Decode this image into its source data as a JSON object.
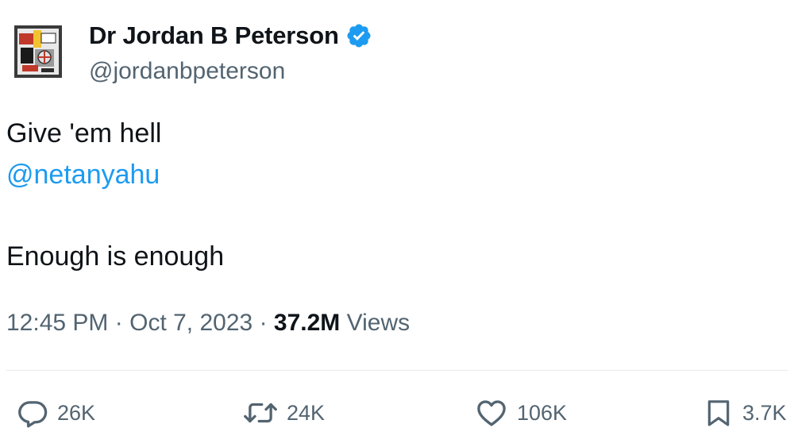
{
  "author": {
    "display_name": "Dr Jordan B Peterson",
    "handle": "@jordanbpeterson",
    "verified": true,
    "verified_badge_color": "#1d9bf0",
    "avatar_icon": "avatar-image"
  },
  "tweet": {
    "line1": "Give 'em hell",
    "mention": "@netanyahu",
    "line3": "Enough is enough",
    "mention_color": "#1d9bf0"
  },
  "meta": {
    "time": "12:45 PM",
    "separator": "·",
    "date": "Oct 7, 2023",
    "views_count": "37.2M",
    "views_label": "Views"
  },
  "actions": {
    "reply": {
      "icon": "reply-icon",
      "count": "26K"
    },
    "retweet": {
      "icon": "retweet-icon",
      "count": "24K"
    },
    "like": {
      "icon": "heart-icon",
      "count": "106K"
    },
    "bookmark": {
      "icon": "bookmark-icon",
      "count": "3.7K"
    }
  }
}
